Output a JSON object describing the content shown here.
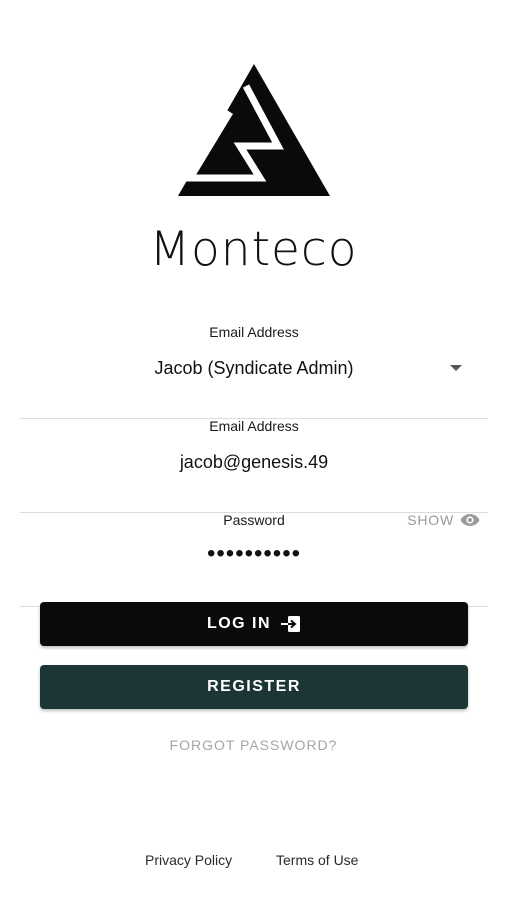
{
  "brand": {
    "name": "Monteco"
  },
  "account_select": {
    "label": "Email Address",
    "selected": "Jacob (Syndicate Admin)"
  },
  "email": {
    "label": "Email Address",
    "value": "jacob@genesis.49"
  },
  "password": {
    "label": "Password",
    "masked_value": "••••••••••",
    "show_label": "SHOW",
    "show_icon": "eye-icon"
  },
  "buttons": {
    "login_label": "LOG IN",
    "login_icon": "login-icon",
    "register_label": "REGISTER",
    "forgot_label": "FORGOT PASSWORD?"
  },
  "footer": {
    "privacy": "Privacy Policy",
    "terms": "Terms of Use"
  },
  "colors": {
    "login_button": "#0a0a0a",
    "register_button": "#1b3634",
    "muted_text": "#9a9a9a"
  }
}
